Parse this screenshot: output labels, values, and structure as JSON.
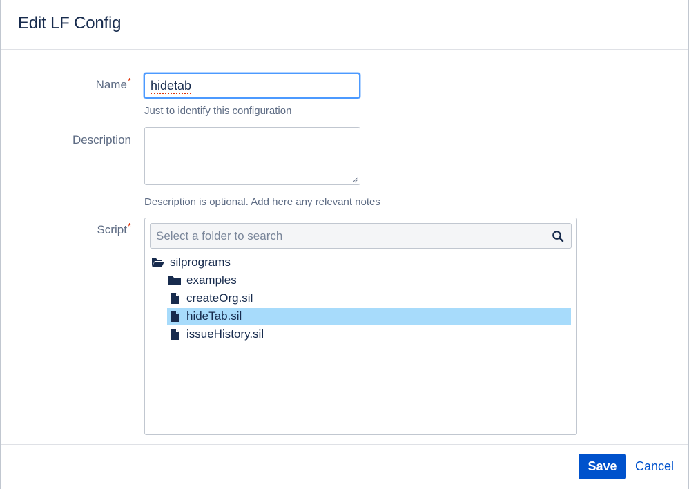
{
  "dialog": {
    "title": "Edit LF Config"
  },
  "form": {
    "name": {
      "label": "Name",
      "required_mark": "*",
      "value": "hidetab",
      "help": "Just to identify this configuration"
    },
    "description": {
      "label": "Description",
      "value": "",
      "help": "Description is optional. Add here any relevant notes"
    },
    "script": {
      "label": "Script",
      "required_mark": "*",
      "search_placeholder": "Select a folder to search",
      "tree": [
        {
          "label": "silprograms",
          "icon": "folder-open-icon",
          "level": 0,
          "selected": false
        },
        {
          "label": "examples",
          "icon": "folder-icon",
          "level": 1,
          "selected": false
        },
        {
          "label": "createOrg.sil",
          "icon": "file-icon",
          "level": 1,
          "selected": false
        },
        {
          "label": "hideTab.sil",
          "icon": "file-icon",
          "level": 1,
          "selected": true
        },
        {
          "label": "issueHistory.sil",
          "icon": "file-icon",
          "level": 1,
          "selected": false
        }
      ]
    }
  },
  "footer": {
    "save_label": "Save",
    "cancel_label": "Cancel"
  },
  "colors": {
    "primary": "#0052cc",
    "selected_row": "#a7dbfb",
    "required": "#de350b",
    "focus_border": "#4c9aff"
  }
}
